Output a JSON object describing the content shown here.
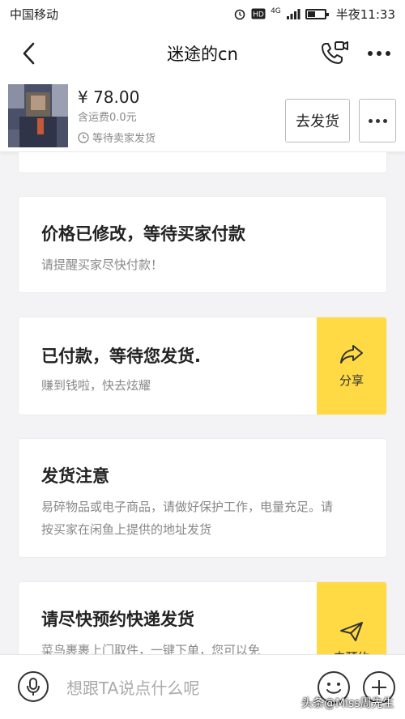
{
  "status_bar": {
    "carrier": "中国移动",
    "network": "4G",
    "time": "半夜11:33"
  },
  "header": {
    "title": "迷途的cn",
    "back_icon": "chevron-left-icon",
    "call_icon": "phone-video-icon",
    "more_icon": "more-dots-icon"
  },
  "product": {
    "price": "¥ 78.00",
    "shipping": "含运费0.0元",
    "status": "等待卖家发货",
    "ship_button": "去发货"
  },
  "cards": [
    {
      "title": "价格已修改，等待买家付款",
      "desc": "请提醒买家尽快付款！"
    },
    {
      "title": "已付款，等待您发货.",
      "desc": "赚到钱啦，快去炫耀",
      "action": "分享",
      "action_icon": "share-arrow-icon"
    },
    {
      "title": "发货注意",
      "desc_line1": "易碎物品或电子商品，请做好保护工作，电量充足。请",
      "desc_line2": "按买家在闲鱼上提供的地址发货"
    },
    {
      "title": "请尽快预约快递发货",
      "desc": "菜鸟裹裹上门取件，一键下单，您可以免",
      "action": "去预约",
      "action_icon": "paper-plane-icon"
    }
  ],
  "input_bar": {
    "placeholder": "想跟TA说点什么呢"
  },
  "watermark": "头条@Miss周先生",
  "colors": {
    "accent": "#ffda44",
    "background": "#f3f3f5"
  }
}
